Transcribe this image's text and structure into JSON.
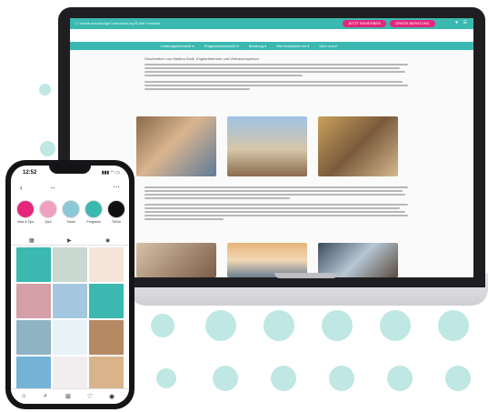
{
  "website": {
    "topbar_left": "☐ Vertrauenswürdige Unterstützung  ✉ Alle Kontakte",
    "cta_primary": "JETZT BEWERBEN",
    "cta_secondary": "GRATIS BERATUNG",
    "topbar_icons": "♥ ☰",
    "nav": [
      "Leistungsübersicht ▾",
      "Programmübersicht ▾",
      "Beratung ▾",
      "Wie funktioniert es ▾",
      "Über uns ▾"
    ],
    "intro_heading": "Geschrieben von Martina Stolk, Englischlehrerin und Vertrauensperson"
  },
  "phone": {
    "time": "12:52",
    "status_icons": "▮▮▮ ◠ ▭",
    "back_icon": "‹",
    "username": "...",
    "more_icon": "⋯",
    "highlights": [
      {
        "label": "Infos & Tips"
      },
      {
        "label": "Q&A"
      },
      {
        "label": "Travel"
      },
      {
        "label": "Programs"
      },
      {
        "label": "TikTok"
      }
    ],
    "tabs": [
      "▦",
      "▶",
      "◉"
    ],
    "bottom_nav": [
      "⌂",
      "⌕",
      "⊞",
      "♡",
      "◉"
    ]
  },
  "colors": {
    "brand_teal": "#3bb9b0",
    "accent_pink": "#e6267b",
    "dot_mint": "#bfe7e4"
  }
}
